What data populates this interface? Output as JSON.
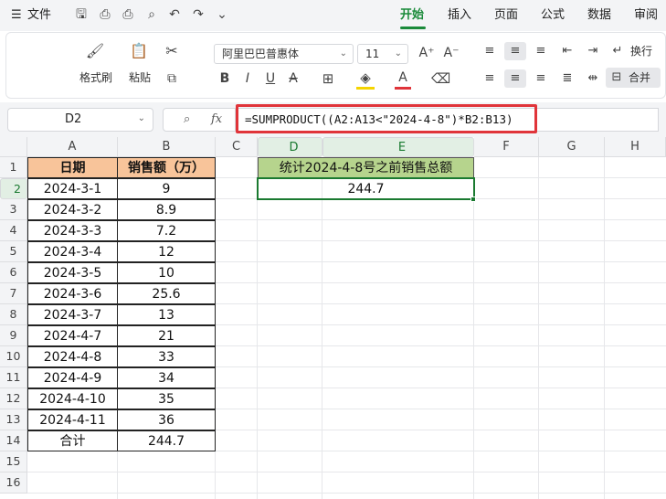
{
  "menu": {
    "hamburger": "☰",
    "file_label": "文件",
    "tabs": [
      {
        "label": "开始",
        "active": true
      },
      {
        "label": "插入",
        "active": false
      },
      {
        "label": "页面",
        "active": false
      },
      {
        "label": "公式",
        "active": false
      },
      {
        "label": "数据",
        "active": false
      },
      {
        "label": "审阅",
        "active": false
      }
    ]
  },
  "ribbon": {
    "format_painter": "格式刷",
    "paste": "粘贴",
    "font_name": "阿里巴巴普惠体",
    "font_size": "11",
    "font_grow": "A⁺",
    "font_shrink": "A⁻",
    "bold": "B",
    "italic": "I",
    "underline": "U",
    "strike": "A",
    "font_color": "A",
    "wrap_label": "换行",
    "merge_label": "合并"
  },
  "formula_bar": {
    "name_box": "D2",
    "fx": "fx",
    "formula": "=SUMPRODUCT((A2:A13<\"2024-4-8\")*B2:B13)"
  },
  "columns": [
    "A",
    "B",
    "C",
    "D",
    "E",
    "F",
    "G",
    "H"
  ],
  "rows": [
    "1",
    "2",
    "3",
    "4",
    "5",
    "6",
    "7",
    "8",
    "9",
    "10",
    "11",
    "12",
    "13",
    "14",
    "15",
    "16"
  ],
  "table": {
    "header": [
      "日期",
      "销售额（万）"
    ],
    "rows": [
      [
        "2024-3-1",
        "9"
      ],
      [
        "2024-3-2",
        "8.9"
      ],
      [
        "2024-3-3",
        "7.2"
      ],
      [
        "2024-3-4",
        "12"
      ],
      [
        "2024-3-5",
        "10"
      ],
      [
        "2024-3-6",
        "25.6"
      ],
      [
        "2024-3-7",
        "13"
      ],
      [
        "2024-4-7",
        "21"
      ],
      [
        "2024-4-8",
        "33"
      ],
      [
        "2024-4-9",
        "34"
      ],
      [
        "2024-4-10",
        "35"
      ],
      [
        "2024-4-11",
        "36"
      ]
    ],
    "total": [
      "合计",
      "244.7"
    ]
  },
  "result": {
    "title": "统计2024-4-8号之前销售总额",
    "value": "244.7"
  },
  "colors": {
    "accent": "#1a8a3a",
    "header_fill": "#f8c49a",
    "result_fill": "#b6d48d",
    "highlight": "#e0343a"
  }
}
